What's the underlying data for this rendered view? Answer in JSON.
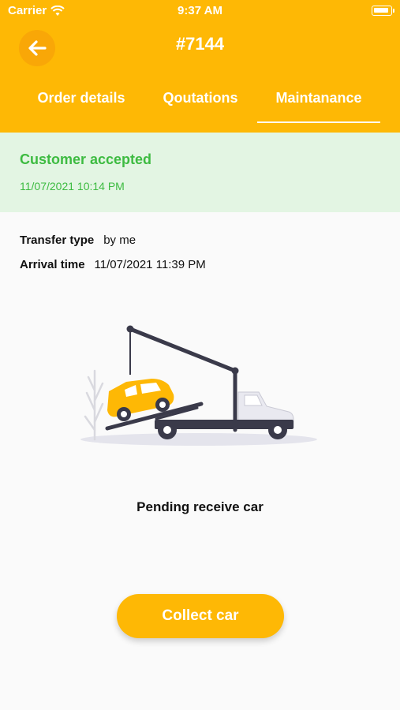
{
  "status_bar": {
    "carrier": "Carrier",
    "time": "9:37 AM"
  },
  "header": {
    "order_number": "#7144",
    "tabs": [
      {
        "label": "Order details"
      },
      {
        "label": "Qoutations"
      },
      {
        "label": "Maintanance"
      }
    ],
    "active_tab": "Maintanance"
  },
  "status": {
    "title": "Customer accepted",
    "datetime": "11/07/2021 10:14 PM"
  },
  "details": {
    "transfer_type_label": "Transfer type",
    "transfer_type_value": "by me",
    "arrival_time_label": "Arrival time",
    "arrival_time_value": "11/07/2021 11:39 PM"
  },
  "illustration": {
    "icon": "tow-truck-illustration"
  },
  "pending_text": "Pending receive car",
  "collect_button": "Collect car",
  "colors": {
    "primary": "#FEB805",
    "success": "#3DBB41",
    "success_bg": "#E3F5E3"
  }
}
